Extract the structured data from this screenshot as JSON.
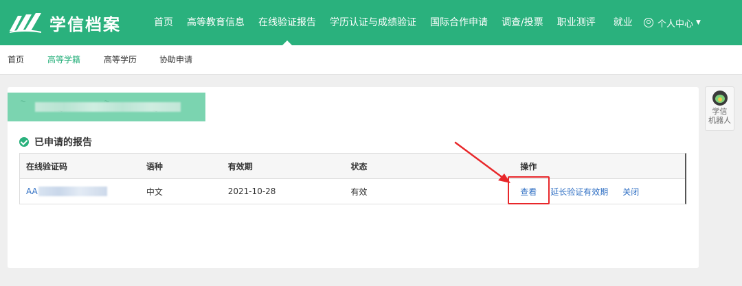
{
  "header": {
    "logo_text": "学信档案",
    "nav": [
      {
        "label": "首页"
      },
      {
        "label": "高等教育信息"
      },
      {
        "label": "在线验证报告",
        "active": true
      },
      {
        "label": "学历认证与成绩验证"
      },
      {
        "label": "国际合作申请"
      },
      {
        "label": "调查/投票"
      },
      {
        "label": "职业测评"
      },
      {
        "label": "就业"
      }
    ],
    "personal_center": "个人中心",
    "brand_color": "#2ab17d"
  },
  "subnav": {
    "items": [
      {
        "label": "首页"
      },
      {
        "label": "高等学籍",
        "active": true
      },
      {
        "label": "高等学历"
      },
      {
        "label": "协助申请"
      }
    ]
  },
  "main": {
    "section_title": "已申请的报告",
    "table": {
      "headers": [
        "在线验证码",
        "语种",
        "有效期",
        "状态",
        "操作"
      ],
      "rows": [
        {
          "code_prefix": "AA",
          "language": "中文",
          "valid_until": "2021-10-28",
          "status": "有效",
          "actions": {
            "view": "查看",
            "extend": "延长验证有效期",
            "close": "关闭"
          }
        }
      ]
    }
  },
  "robot": {
    "label_line1": "学信",
    "label_line2": "机器人"
  },
  "annotation_color": "#e8272a"
}
